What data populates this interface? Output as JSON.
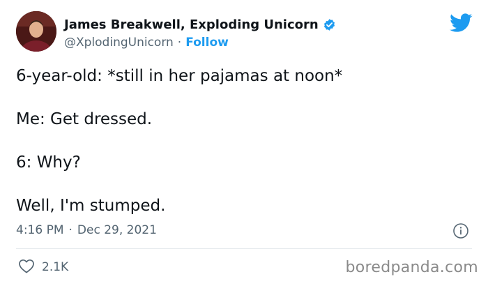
{
  "tweet": {
    "author": {
      "display_name": "James Breakwell, Exploding Unicorn",
      "handle": "@XplodingUnicorn",
      "verified": true
    },
    "separator": "·",
    "follow_label": "Follow",
    "text_lines": [
      "6-year-old: *still in her pajamas at noon*",
      "Me: Get dressed.",
      "6: Why?",
      "Well, I'm stumped."
    ],
    "time": "4:16 PM",
    "date": "Dec 29, 2021",
    "likes": "2.1K"
  },
  "watermark": "boredpanda.com",
  "icons": {
    "platform": "twitter-bird-icon",
    "verified": "verified-badge-icon",
    "info": "info-icon",
    "like": "heart-icon"
  },
  "colors": {
    "accent": "#1d9bf0",
    "text": "#0f1419",
    "muted": "#536471",
    "divider": "#e4e9ec"
  }
}
